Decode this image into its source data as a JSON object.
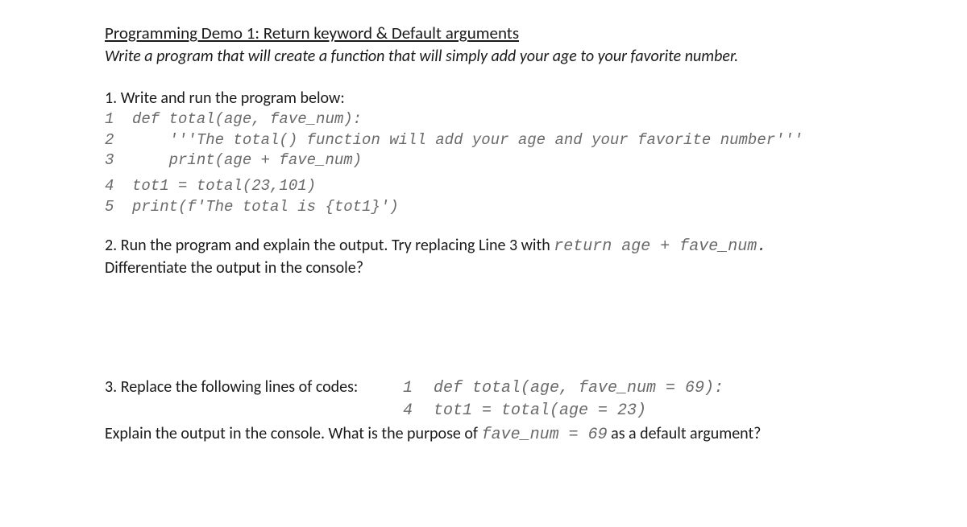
{
  "title": "Programming Demo 1: Return keyword & Default arguments",
  "subtitle": "Write a program that will create a function that will simply add your age to your favorite number.",
  "step1": "1. Write and run the program below:",
  "code1": {
    "l1": {
      "n": "1",
      "t": "def total(age, fave_num):"
    },
    "l2": {
      "n": "2",
      "t": "    '''The total() function will add your age and your favorite number'''"
    },
    "l3": {
      "n": "3",
      "t": "    print(age + fave_num)"
    },
    "l4": {
      "n": "4",
      "t": "tot1 = total(23,101)"
    },
    "l5": {
      "n": "5",
      "t": "print(f'The total is {tot1}')"
    }
  },
  "step2": {
    "pre": "2. Run the program and explain the output. Try replacing Line 3 with ",
    "code": "return age + fave_num",
    "dot": ".",
    "post": "Differentiate the output in the console?"
  },
  "step3": {
    "lead": "3. Replace the following lines of codes:",
    "l1": {
      "n": "1",
      "t": "def total(age, fave_num = 69):"
    },
    "l4": {
      "n": "4",
      "t": "tot1 = total(age = 23)"
    },
    "explain_pre": "Explain the output in the console. What is the purpose of ",
    "explain_code": "fave_num = 69",
    "explain_post": " as a default argument?"
  }
}
